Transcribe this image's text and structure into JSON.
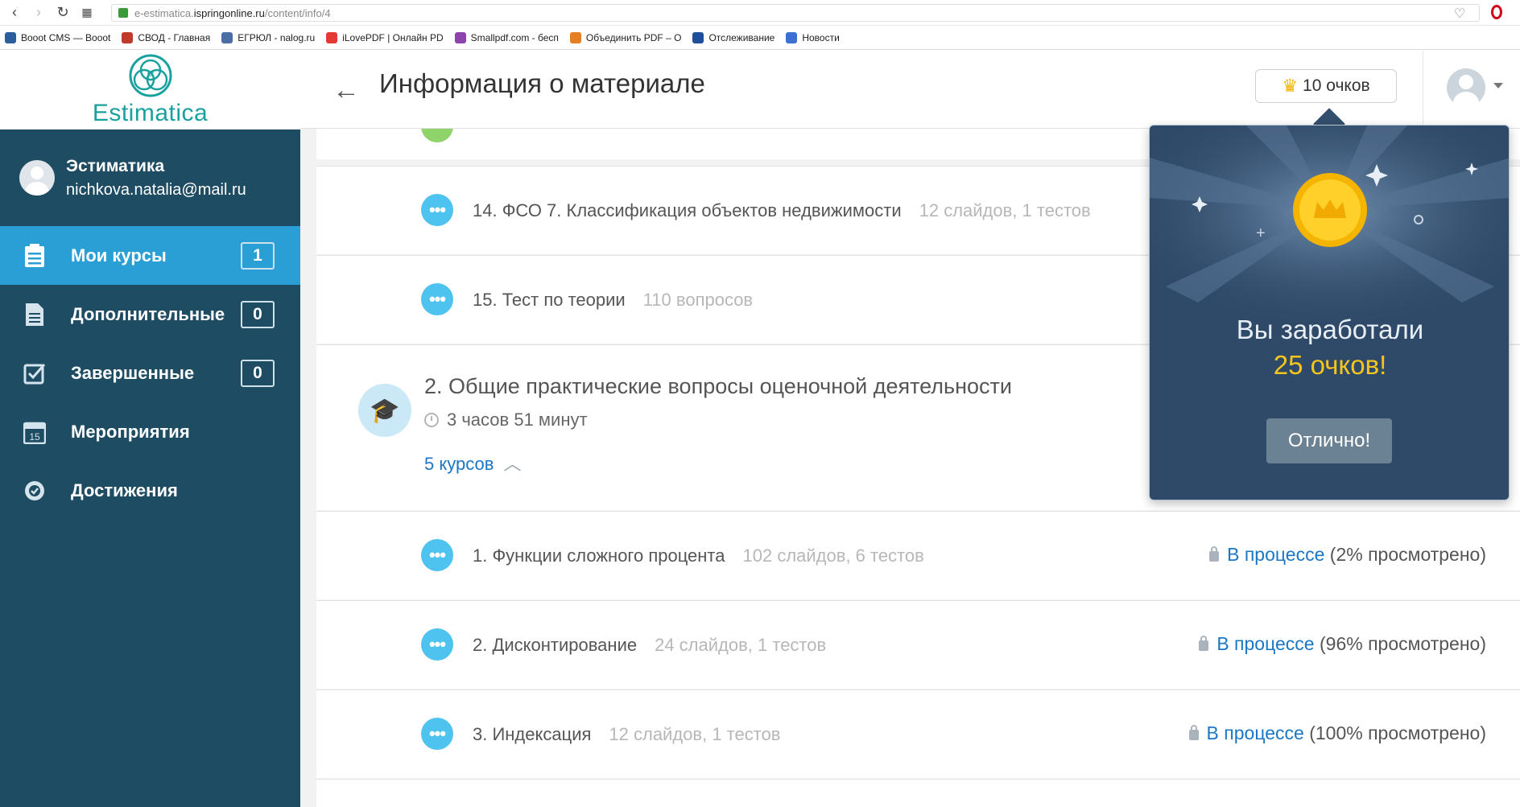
{
  "browser": {
    "url_prefix": "e-estimatica.",
    "url_host": "ispringonline.ru",
    "url_path": "/content/info/4",
    "bookmarks": [
      {
        "label": "Booot CMS — Booot",
        "icon_color": "#2c5e9e"
      },
      {
        "label": "СВОД - Главная",
        "icon_color": "#c0392b"
      },
      {
        "label": "ЕГРЮЛ - nalog.ru",
        "icon_color": "#4a6fa5"
      },
      {
        "label": "iLovePDF | Онлайн PD",
        "icon_color": "#e53935"
      },
      {
        "label": "Smallpdf.com - бесп",
        "icon_color": "#8e44ad"
      },
      {
        "label": "Объединить PDF – О",
        "icon_color": "#e67e22"
      },
      {
        "label": "Отслеживание",
        "icon_color": "#1f4e9a"
      },
      {
        "label": "Новости",
        "icon_color": "#3b6fd1"
      }
    ]
  },
  "sidebar": {
    "logo_text": "Estimatica",
    "user_name": "Эстиматика",
    "user_email": "nichkova.natalia@mail.ru",
    "items": [
      {
        "label": "Мои курсы",
        "badge": "1",
        "icon": "list-icon",
        "active": true
      },
      {
        "label": "Дополнительные",
        "badge": "0",
        "icon": "document-icon",
        "active": false
      },
      {
        "label": "Завершенные",
        "badge": "0",
        "icon": "checkbox-icon",
        "active": false
      },
      {
        "label": "Мероприятия",
        "badge": "",
        "icon": "calendar-icon",
        "active": false
      },
      {
        "label": "Достижения",
        "badge": "",
        "icon": "medal-icon",
        "active": false
      }
    ]
  },
  "header": {
    "title": "Информация о материале",
    "points_label": "10 очков"
  },
  "content": {
    "rows_top": [
      {
        "title": "14. ФСО 7. Классификация объектов недвижимости",
        "meta": "12 слайдов, 1 тестов"
      },
      {
        "title": "15. Тест по теории",
        "meta": "110 вопросов"
      }
    ],
    "section": {
      "title": "2. Общие практические вопросы оценочной деятельности",
      "duration": "3 часов 51 минут",
      "courses_toggle": "5 курсов"
    },
    "rows_bottom": [
      {
        "title": "1. Функции сложного процента",
        "meta": "102 слайдов, 6 тестов",
        "status_link": "В процессе",
        "status_detail": " (2% просмотрено)"
      },
      {
        "title": "2. Дисконтирование",
        "meta": "24 слайдов, 1 тестов",
        "status_link": "В процессе",
        "status_detail": " (96% просмотрено)"
      },
      {
        "title": "3. Индексация",
        "meta": "12 слайдов, 1 тестов",
        "status_link": "В процессе",
        "status_detail": " (100% просмотрено)"
      }
    ]
  },
  "popup": {
    "line1": "Вы заработали",
    "line2": "25 очков!",
    "button_label": "Отлично!"
  },
  "colors": {
    "sidebar_bg": "#1e4c63",
    "active_item": "#2a9fd6",
    "popup_bg": "#2f4a69",
    "accent_link": "#1a77c6",
    "points_gold": "#f7c51b"
  }
}
